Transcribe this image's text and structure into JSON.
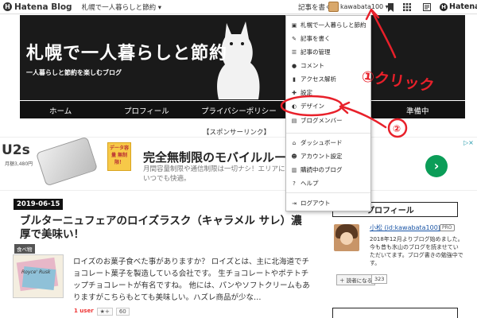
{
  "topbar": {
    "logo": "Hatena Blog",
    "logo_mark": "H",
    "blog_switch": "札幌で一人暮らしと節約 ▾",
    "write": "記事を書く",
    "user": "kawabata100 ▾",
    "brand_right": "Hatena",
    "brand_right_mark": "H",
    "icons": [
      "bookmark-icon",
      "grid-icon",
      "notification-icon"
    ]
  },
  "header": {
    "title": "札幌で一人暮らしと節約",
    "subtitle": "一人暮らしと節約を楽しむブログ"
  },
  "nav": {
    "items": [
      "ホーム",
      "プロフィール",
      "プライバシーポリシー",
      "準備中"
    ]
  },
  "sponsored": "【スポンサーリンク】",
  "ad": {
    "brand": "U2s",
    "badge": "データ容量 無制限！",
    "price": "月額3,480円",
    "headline": "完全無制限のモバイルルーター",
    "description": "月間容量制限や通信制限は一切ナシ！エリアに いつでも快適。",
    "go": "›",
    "adinfo": "▷×"
  },
  "article": {
    "date": "2019-06-15",
    "title": "ブルターニュフェアのロイズラスク（キャラメル サレ）濃厚で美味い！",
    "category": "食べ物",
    "thumb_text": "Royce' Rusk",
    "excerpt": "ロイズのお菓子食べた事がありますか？ ロイズとは、主に北海道でチョコレート菓子を製造している会社です。 生チョコレートやポテトチップチョコレートが有名ですね。 他には、パンやソフトクリームもありますがこちらもとても美味しい。ハズレ商品が少な…",
    "share": {
      "users": "1 user",
      "star": "★+",
      "count": "60"
    }
  },
  "sidebar": {
    "profile_head": "プロフィール",
    "name": "小松 (id:kawabata100)",
    "pro": "PRO",
    "desc": "2018年12月よりブログ始めました。 今も昔も氷山のブログを読ませていただいてます。ブログ書きの勉強中です。",
    "reader_button": "＋ 読者になる",
    "reader_count": "323"
  },
  "dropdown": {
    "items": [
      {
        "icon": "blog-icon",
        "glyph": "▣",
        "label": "札幌で一人暮らしと節約"
      },
      {
        "icon": "write-icon",
        "glyph": "✎",
        "label": "記事を書く"
      },
      {
        "icon": "manage-icon",
        "glyph": "☰",
        "label": "記事の管理"
      },
      {
        "icon": "comment-icon",
        "glyph": "●",
        "label": "コメント"
      },
      {
        "icon": "analytics-icon",
        "glyph": "▮",
        "label": "アクセス解析"
      },
      {
        "icon": "settings-icon",
        "glyph": "✚",
        "label": "設定"
      },
      {
        "icon": "design-icon",
        "glyph": "◐",
        "label": "デザイン"
      },
      {
        "icon": "members-icon",
        "glyph": "▤",
        "label": "ブログメンバー"
      },
      {
        "icon": "dashboard-icon",
        "glyph": "⌂",
        "label": "ダッシュボード"
      },
      {
        "icon": "account-icon",
        "glyph": "☻",
        "label": "アカウント設定"
      },
      {
        "icon": "reading-icon",
        "glyph": "▥",
        "label": "購読中のブログ"
      },
      {
        "icon": "help-icon",
        "glyph": "?",
        "label": "ヘルプ"
      },
      {
        "icon": "logout-icon",
        "glyph": "⇥",
        "label": "ログアウト"
      }
    ]
  },
  "annotations": {
    "step1": "①クリック",
    "step2": "②",
    "color": "#e8202a"
  }
}
